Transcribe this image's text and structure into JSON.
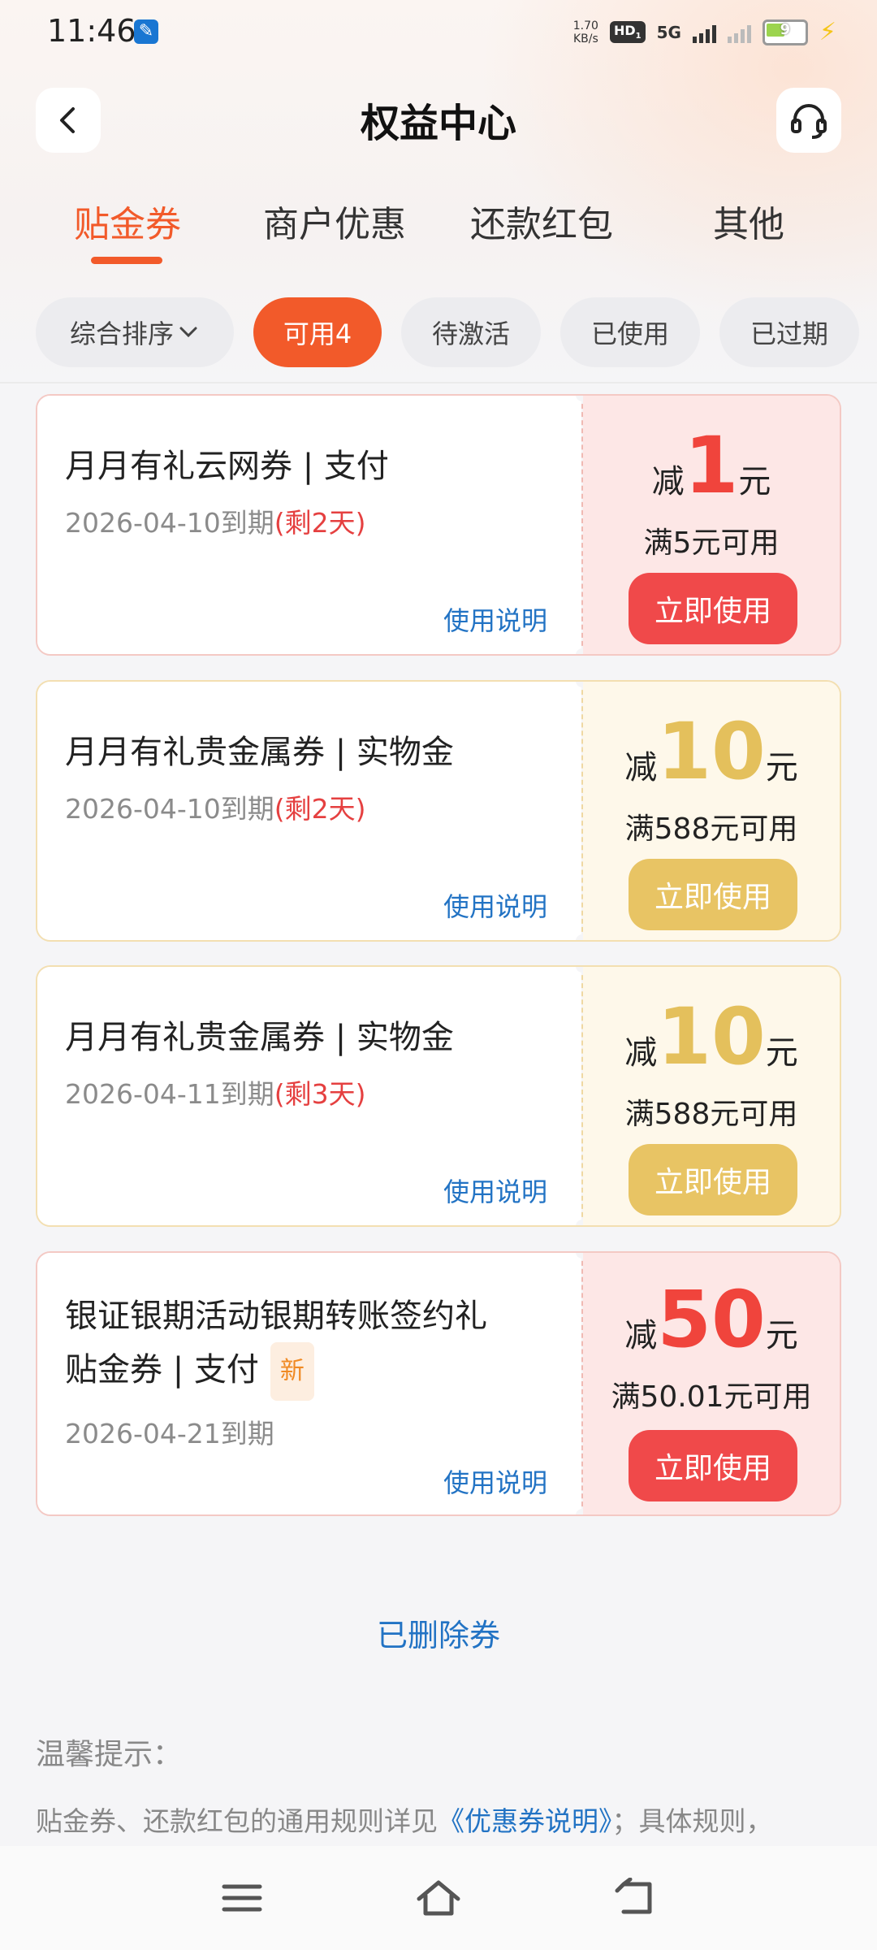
{
  "status_bar": {
    "time": "11:46",
    "net_speed_value": "1.70",
    "net_speed_unit": "KB/s",
    "hd": "HD",
    "hd_sub": "1",
    "network": "5G",
    "battery": "9"
  },
  "header": {
    "title": "权益中心"
  },
  "tabs": [
    {
      "label": "贴金券",
      "active": true
    },
    {
      "label": "商户优惠"
    },
    {
      "label": "还款红包"
    },
    {
      "label": "其他"
    }
  ],
  "filters": [
    {
      "label": "综合排序"
    },
    {
      "label": "可用4",
      "active": true
    },
    {
      "label": "待激活"
    },
    {
      "label": "已使用"
    },
    {
      "label": "已过期"
    }
  ],
  "coupons": [
    {
      "title": "月月有礼云网券 | 支付",
      "expiry": "2026-04-10到期",
      "remaining": "(剩2天)",
      "link": "使用说明",
      "prefix": "减",
      "amount": "1",
      "suffix": "元",
      "condition": "满5元可用",
      "button": "立即使用",
      "theme": "#f0443c"
    },
    {
      "title": "月月有礼贵金属券 | 实物金",
      "expiry": "2026-04-10到期",
      "remaining": "(剩2天)",
      "link": "使用说明",
      "prefix": "减",
      "amount": "10",
      "suffix": "元",
      "condition": "满588元可用",
      "button": "立即使用",
      "theme": "#e4c05c"
    },
    {
      "title": "月月有礼贵金属券 | 实物金",
      "expiry": "2026-04-11到期",
      "remaining": "(剩3天)",
      "link": "使用说明",
      "prefix": "减",
      "amount": "10",
      "suffix": "元",
      "condition": "满588元可用",
      "button": "立即使用",
      "theme": "#e4c05c"
    },
    {
      "title_line1": "银证银期活动银期转账签约礼",
      "title_line2": "贴金券 | 支付",
      "badge": "新",
      "expiry": "2026-04-21到期",
      "link": "使用说明",
      "prefix": "减",
      "amount": "50",
      "suffix": "元",
      "condition": "满50.01元可用",
      "button": "立即使用",
      "theme": "#f0443c"
    }
  ],
  "deleted_link": "已删除券",
  "tips": {
    "title": "温馨提示：",
    "text_before": "贴金券、还款红包的通用规则详见",
    "link": "《优惠券说明》",
    "text_after": "；具体规则，"
  },
  "nav_icons": [
    "menu-icon",
    "home-icon",
    "back-icon"
  ]
}
